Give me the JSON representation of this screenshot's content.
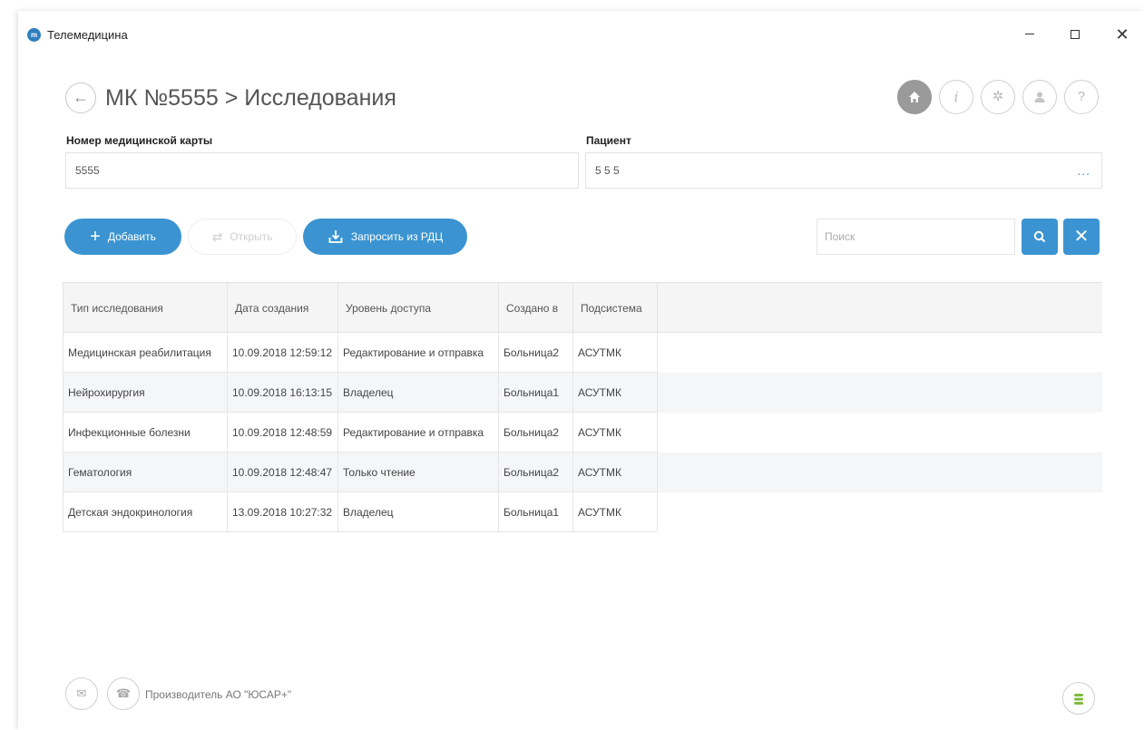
{
  "window": {
    "title": "Телемедицина",
    "logo_text": "m"
  },
  "header": {
    "title": "МК №5555 > Исследования"
  },
  "fields": {
    "card_label": "Номер медицинской карты",
    "card_value": "5555",
    "patient_label": "Пациент",
    "patient_value": "5 5 5",
    "patient_more": "..."
  },
  "toolbar": {
    "add_label": "Добавить",
    "open_label": "Открыть",
    "request_label": "Запросить из РДЦ",
    "search_placeholder": "Поиск"
  },
  "table": {
    "columns": [
      "Тип исследования",
      "Дата создания",
      "Уровень доступа",
      "Создано в",
      "Подсистема"
    ],
    "rows": [
      [
        "Медицинская реабилитация",
        "10.09.2018 12:59:12",
        "Редактирование и отправка",
        "Больница2",
        "АСУТМК"
      ],
      [
        "Нейрохирургия",
        "10.09.2018 16:13:15",
        "Владелец",
        "Больница1",
        "АСУТМК"
      ],
      [
        "Инфекционные болезни",
        "10.09.2018 12:48:59",
        "Редактирование и отправка",
        "Больница2",
        "АСУТМК"
      ],
      [
        "Гематология",
        "10.09.2018 12:48:47",
        "Только чтение",
        "Больница2",
        "АСУТМК"
      ],
      [
        "Детская эндокринология",
        "13.09.2018 10:27:32",
        "Владелец",
        "Больница1",
        "АСУТМК"
      ]
    ]
  },
  "footer": {
    "manufacturer": "Производитель АО \"ЮСАР+\""
  },
  "colors": {
    "accent": "#3b94d1",
    "home_icon_bg": "#9a9a9a",
    "db_icon": "#7dbb3a"
  }
}
